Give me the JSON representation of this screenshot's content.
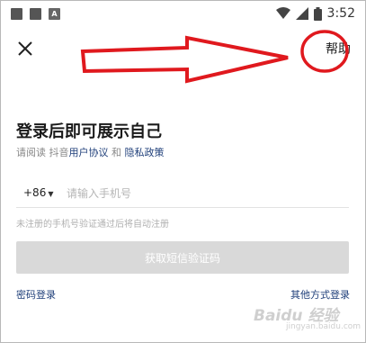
{
  "status_bar": {
    "time": "3:52",
    "notification_letter": "A",
    "icons": [
      "notification-square-icon",
      "notification-square-icon",
      "app-a-icon",
      "wifi-icon",
      "signal-icon",
      "battery-icon"
    ]
  },
  "header": {
    "close_icon": "close-icon",
    "help_label": "帮助"
  },
  "login": {
    "title": "登录后即可展示自己",
    "agreement_prefix": "请阅读 抖音",
    "user_agreement": "用户协议",
    "and": " 和 ",
    "privacy_policy": "隐私政策",
    "country_code": "+86",
    "phone_placeholder": "请输入手机号",
    "hint": "未注册的手机号验证通过后将自动注册",
    "get_code_button": "获取短信验证码",
    "password_login": "密码登录",
    "other_login": "其他方式登录"
  },
  "annotation": {
    "color": "#e0191e",
    "type": "arrow pointing right to circled help link"
  },
  "watermark": {
    "text": "Baidu 经验",
    "subtext": "jingyan.baidu.com"
  },
  "colors": {
    "link": "#1f3f7a",
    "button_disabled": "#d9d9d9",
    "annotation_red": "#e0191e"
  }
}
